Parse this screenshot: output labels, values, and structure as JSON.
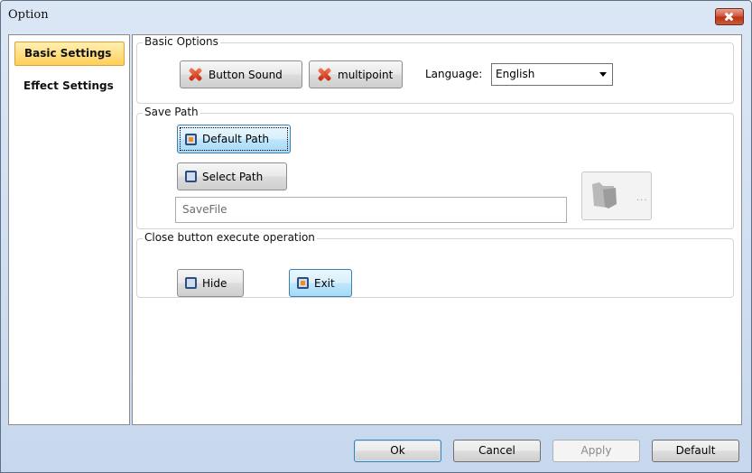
{
  "window": {
    "title": "Option"
  },
  "sidebar": {
    "items": [
      {
        "label": "Basic Settings",
        "active": true
      },
      {
        "label": "Effect Settings",
        "active": false
      }
    ]
  },
  "basic_options": {
    "label": "Basic Options",
    "button_sound": "Button Sound",
    "multipoint": "multipoint",
    "language_label": "Language:",
    "language_value": "English"
  },
  "save_path": {
    "label": "Save Path",
    "default_path": "Default Path",
    "select_path": "Select Path",
    "path_value": "SaveFile",
    "browse_dots": "..."
  },
  "close_op": {
    "label": "Close button execute operation",
    "hide": "Hide",
    "exit": "Exit"
  },
  "footer": {
    "ok": "Ok",
    "cancel": "Cancel",
    "apply": "Apply",
    "default": "Default"
  },
  "colors": {
    "accent": "#3c7fb1",
    "active_tab": "#ffcf5a",
    "close_red": "#c95a3c"
  }
}
